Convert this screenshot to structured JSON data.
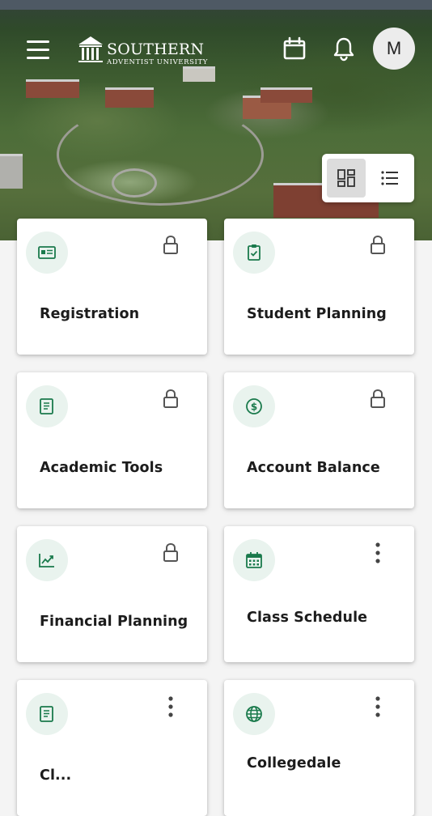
{
  "header": {
    "logo": {
      "name": "SOUTHERN",
      "subtitle": "ADVENTIST UNIVERSITY"
    },
    "icons": {
      "menu": "hamburger-menu-icon",
      "calendar": "calendar-icon",
      "notifications": "bell-icon"
    },
    "avatar_initial": "M"
  },
  "view_toggle": {
    "active": "grid",
    "options": [
      "grid-view-icon",
      "list-view-icon"
    ]
  },
  "colors": {
    "accent": "#1a7a4c",
    "icon_bg": "#e9f3ee",
    "card_bg": "#ffffff",
    "page_bg": "#f4f4f4"
  },
  "cards": [
    {
      "title": "Registration",
      "icon": "id-card-icon",
      "action": "lock-icon"
    },
    {
      "title": "Student Planning",
      "icon": "clipboard-check-icon",
      "action": "lock-icon"
    },
    {
      "title": "Academic Tools",
      "icon": "book-icon",
      "action": "lock-icon"
    },
    {
      "title": "Account Balance",
      "icon": "dollar-circle-icon",
      "action": "lock-icon"
    },
    {
      "title": "Financial Planning",
      "icon": "trending-up-icon",
      "action": "lock-icon"
    },
    {
      "title": "Class Schedule",
      "icon": "calendar-grid-icon",
      "action": "more-vert-icon"
    },
    {
      "title": "Cl...",
      "icon": "book-icon",
      "action": "more-vert-icon"
    },
    {
      "title": "Collegedale",
      "icon": "globe-icon",
      "action": "more-vert-icon"
    }
  ]
}
